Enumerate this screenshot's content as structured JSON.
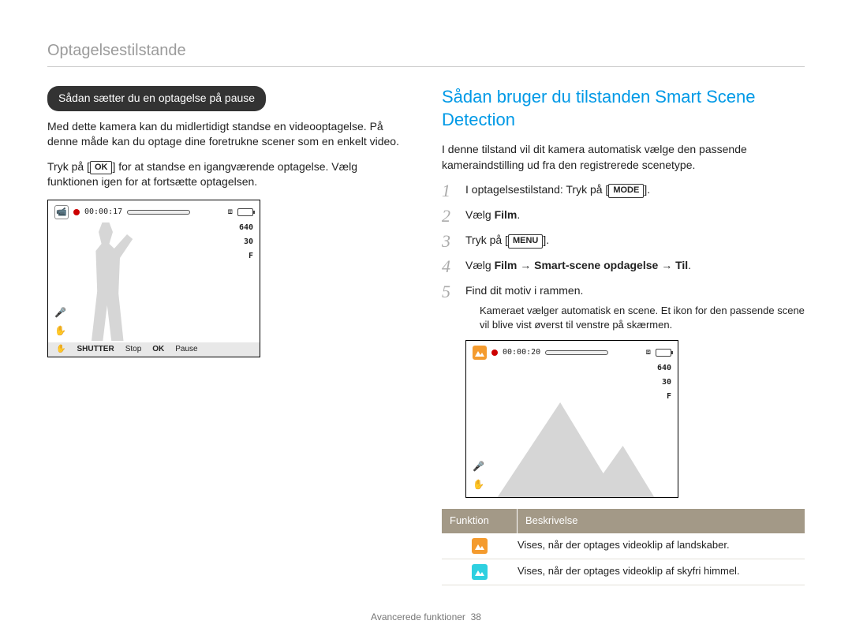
{
  "header": {
    "breadcrumb": "Optagelsestilstande"
  },
  "left": {
    "pill": "Sådan sætter du en optagelse på pause",
    "p1": "Med dette kamera kan du midlertidigt standse en videooptagelse. På denne måde kan du optage dine foretrukne scener som en enkelt video.",
    "p2a": "Tryk på [",
    "p2_btn": "OK",
    "p2b": "] for at standse en igangværende optagelse. Vælg funktionen igen for at fortsætte optagelsen.",
    "lcd": {
      "time": "00:00:17",
      "res": "640",
      "fps": "30",
      "focus": "F",
      "shutter_label": "SHUTTER",
      "shutter_action": "Stop",
      "ok_label": "OK",
      "ok_action": "Pause"
    }
  },
  "right": {
    "title": "Sådan bruger du tilstanden Smart Scene Detection",
    "intro": "I denne tilstand vil dit kamera automatisk vælge den passende kameraindstilling ud fra den registrerede scenetype.",
    "steps": [
      {
        "pre": "I optagelsestilstand: Tryk på [",
        "btn": "MODE",
        "post": "]."
      },
      {
        "pre": "Vælg ",
        "bold": "Film",
        "post": "."
      },
      {
        "pre": "Tryk på [",
        "btn": "MENU",
        "post": "]."
      },
      {
        "pre": "Vælg ",
        "bold": "Film → Smart-scene opdagelse → Til",
        "post": "."
      },
      {
        "pre": "Find dit motiv i rammen.",
        "sub": "Kameraet vælger automatisk en scene. Et ikon for den passende scene vil blive vist øverst til venstre på skærmen."
      }
    ],
    "lcd": {
      "time": "00:00:20",
      "res": "640",
      "fps": "30",
      "focus": "F"
    },
    "table": {
      "h1": "Funktion",
      "h2": "Beskrivelse",
      "rows": [
        {
          "icon": "landscape-orange",
          "desc": "Vises, når der optages videoklip af landskaber."
        },
        {
          "icon": "sky-cyan",
          "desc": "Vises, når der optages videoklip af skyfri himmel."
        }
      ]
    }
  },
  "footer": {
    "section": "Avancerede funktioner",
    "page": "38"
  }
}
